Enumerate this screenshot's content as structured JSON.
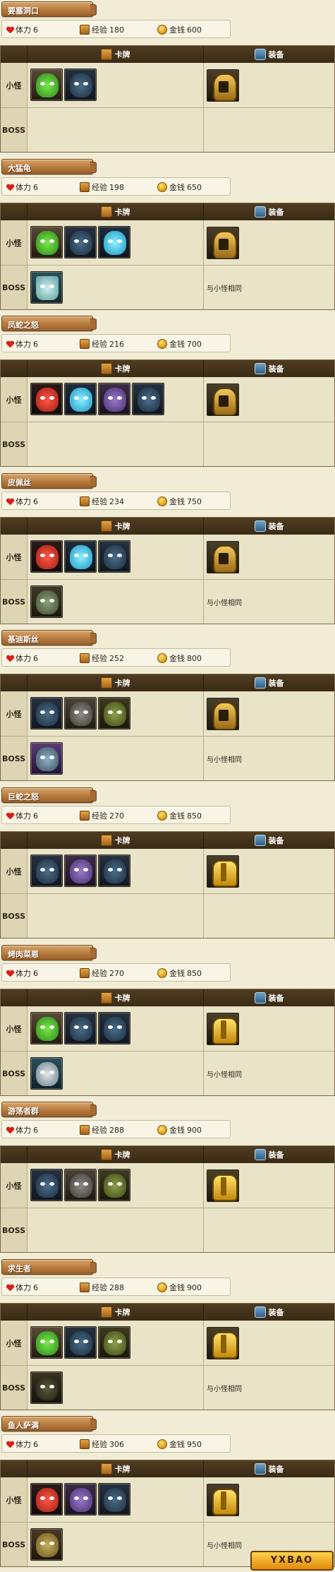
{
  "labels": {
    "stamina": "体力",
    "exp": "经验",
    "gold": "金钱",
    "cards_header": "卡牌",
    "equip_header": "装备",
    "minion": "小怪",
    "boss": "BOSS",
    "same_as_minion": "与小怪相同"
  },
  "watermark": "YXBAO",
  "sections": [
    {
      "title": "要塞洞口",
      "stamina": "6",
      "exp": "180",
      "gold": "600",
      "minion_cards": [
        "green",
        "blue"
      ],
      "minion_equip": "helmet",
      "boss_cards": [],
      "boss_equip_text": ""
    },
    {
      "title": "大猛龟",
      "stamina": "6",
      "exp": "198",
      "gold": "650",
      "minion_cards": [
        "green",
        "blue",
        "cyan"
      ],
      "minion_equip": "helmet",
      "boss_cards": [
        "ghost"
      ],
      "boss_equip_text": "与小怪相同"
    },
    {
      "title": "凤蛇之怒",
      "stamina": "6",
      "exp": "216",
      "gold": "700",
      "minion_cards": [
        "red",
        "cyan",
        "purple",
        "blue"
      ],
      "minion_equip": "helmet",
      "boss_cards": [],
      "boss_equip_text": ""
    },
    {
      "title": "皮佩丝",
      "stamina": "6",
      "exp": "234",
      "gold": "750",
      "minion_cards": [
        "red",
        "cyan",
        "blue"
      ],
      "minion_equip": "helmet",
      "boss_cards": [
        "zombie"
      ],
      "boss_equip_text": "与小怪相同"
    },
    {
      "title": "基迪斯丝",
      "stamina": "6",
      "exp": "252",
      "gold": "800",
      "minion_cards": [
        "blue",
        "grey",
        "olive"
      ],
      "minion_equip": "helmet",
      "boss_cards": [
        "wizard"
      ],
      "boss_equip_text": "与小怪相同"
    },
    {
      "title": "巨蛇之怒",
      "stamina": "6",
      "exp": "270",
      "gold": "850",
      "minion_cards": [
        "blue",
        "purple",
        "blue"
      ],
      "minion_equip": "armor",
      "boss_cards": [],
      "boss_equip_text": ""
    },
    {
      "title": "烤肉菜恩",
      "stamina": "6",
      "exp": "270",
      "gold": "850",
      "minion_cards": [
        "green",
        "blue",
        "blue"
      ],
      "minion_equip": "armor",
      "boss_cards": [
        "elder"
      ],
      "boss_equip_text": "与小怪相同"
    },
    {
      "title": "游荡者群",
      "stamina": "6",
      "exp": "288",
      "gold": "900",
      "minion_cards": [
        "blue",
        "grey",
        "olive"
      ],
      "minion_equip": "armor",
      "boss_cards": [],
      "boss_equip_text": ""
    },
    {
      "title": "求生者",
      "stamina": "6",
      "exp": "288",
      "gold": "900",
      "minion_cards": [
        "green",
        "blue",
        "olive"
      ],
      "minion_equip": "armor",
      "boss_cards": [
        "dark"
      ],
      "boss_equip_text": "与小怪相同"
    },
    {
      "title": "鱼人萨满",
      "stamina": "6",
      "exp": "306",
      "gold": "950",
      "minion_cards": [
        "red",
        "purple",
        "blue"
      ],
      "minion_equip": "armor",
      "boss_cards": [
        "fish"
      ],
      "boss_equip_text": "与小怪相同"
    }
  ]
}
